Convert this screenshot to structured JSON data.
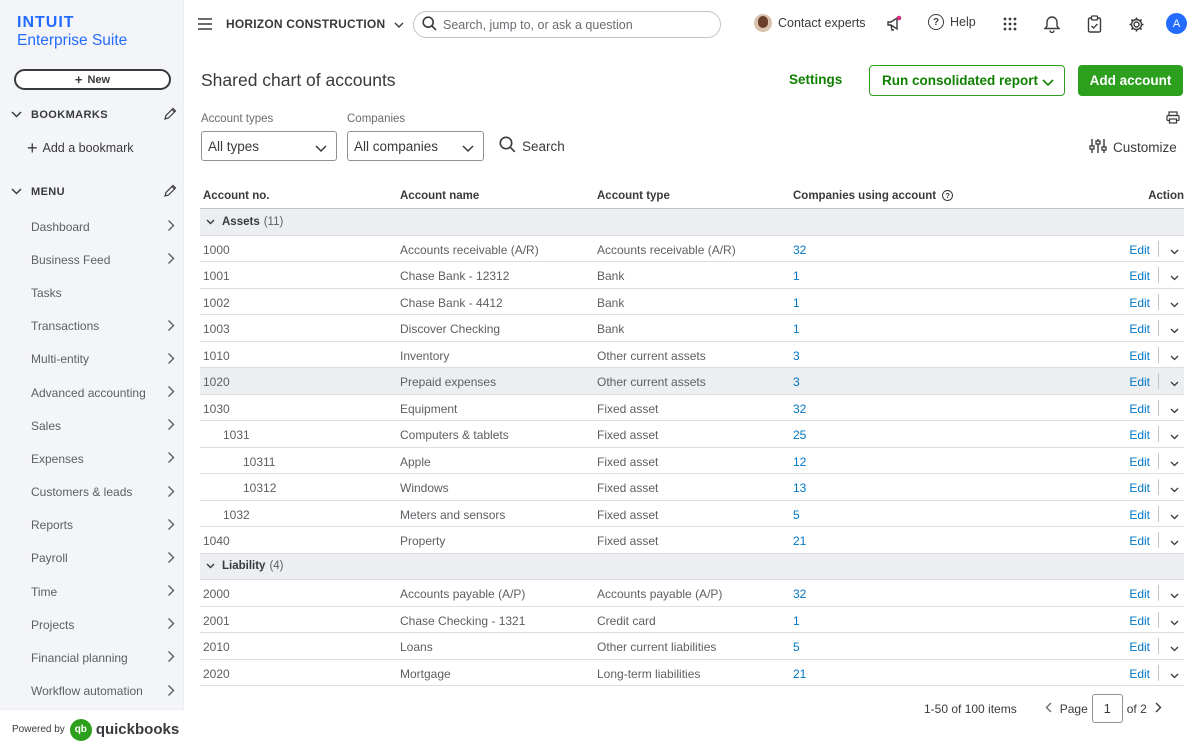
{
  "brand": {
    "line1": "INTUIT",
    "line2": "Enterprise Suite",
    "accent": "#236cff",
    "green": "#2ca01c"
  },
  "sidebar": {
    "new_label": "New",
    "bookmarks_label": "BOOKMARKS",
    "add_bookmark_label": "Add a bookmark",
    "menu_label": "MENU",
    "items": [
      {
        "label": "Dashboard",
        "arrow": true
      },
      {
        "label": "Business Feed",
        "arrow": true
      },
      {
        "label": "Tasks",
        "arrow": false
      },
      {
        "label": "Transactions",
        "arrow": true
      },
      {
        "label": "Multi-entity",
        "arrow": true
      },
      {
        "label": "Advanced accounting",
        "arrow": true
      },
      {
        "label": "Sales",
        "arrow": true
      },
      {
        "label": "Expenses",
        "arrow": true
      },
      {
        "label": "Customers & leads",
        "arrow": true
      },
      {
        "label": "Reports",
        "arrow": true
      },
      {
        "label": "Payroll",
        "arrow": true
      },
      {
        "label": "Time",
        "arrow": true
      },
      {
        "label": "Projects",
        "arrow": true
      },
      {
        "label": "Financial planning",
        "arrow": true
      },
      {
        "label": "Workflow automation",
        "arrow": true
      }
    ],
    "powered_by": "Powered by",
    "qb_mark": "qb",
    "qb_word": "quickbooks"
  },
  "topbar": {
    "company": "HORIZON CONSTRUCTION",
    "search_placeholder": "Search, jump to, or ask a question",
    "contact_label": "Contact experts",
    "help_label": "Help",
    "user_initial": "A"
  },
  "page": {
    "title": "Shared chart of accounts",
    "settings_label": "Settings",
    "run_report_label": "Run consolidated report",
    "add_account_label": "Add account",
    "account_types_label": "Account types",
    "account_types_value": "All types",
    "companies_label": "Companies",
    "companies_value": "All companies",
    "search_label": "Search",
    "customize_label": "Customize"
  },
  "table": {
    "headers": {
      "no": "Account no.",
      "name": "Account name",
      "type": "Account type",
      "companies": "Companies using account",
      "action": "Action"
    },
    "edit_label": "Edit",
    "groups": [
      {
        "name": "Assets",
        "count": "(11)",
        "rows": [
          {
            "no": "1000",
            "indent": 0,
            "name": "Accounts receivable (A/R)",
            "type": "Accounts receivable (A/R)",
            "companies": "32",
            "highlight": false
          },
          {
            "no": "1001",
            "indent": 0,
            "name": "Chase Bank - 12312",
            "type": "Bank",
            "companies": "1",
            "highlight": false
          },
          {
            "no": "1002",
            "indent": 0,
            "name": "Chase Bank - 4412",
            "type": "Bank",
            "companies": "1",
            "highlight": false
          },
          {
            "no": "1003",
            "indent": 0,
            "name": "Discover Checking",
            "type": "Bank",
            "companies": "1",
            "highlight": false
          },
          {
            "no": "1010",
            "indent": 0,
            "name": "Inventory",
            "type": "Other current assets",
            "companies": "3",
            "highlight": false
          },
          {
            "no": "1020",
            "indent": 0,
            "name": "Prepaid expenses",
            "type": "Other current assets",
            "companies": "3",
            "highlight": true
          },
          {
            "no": "1030",
            "indent": 0,
            "name": "Equipment",
            "type": "Fixed asset",
            "companies": "32",
            "highlight": false
          },
          {
            "no": "1031",
            "indent": 1,
            "name": "Computers & tablets",
            "type": "Fixed asset",
            "companies": "25",
            "highlight": false
          },
          {
            "no": "10311",
            "indent": 2,
            "name": "Apple",
            "type": "Fixed asset",
            "companies": "12",
            "highlight": false
          },
          {
            "no": "10312",
            "indent": 2,
            "name": "Windows",
            "type": "Fixed asset",
            "companies": "13",
            "highlight": false
          },
          {
            "no": "1032",
            "indent": 1,
            "name": "Meters and sensors",
            "type": "Fixed asset",
            "companies": "5",
            "highlight": false
          },
          {
            "no": "1040",
            "indent": 0,
            "name": "Property",
            "type": "Fixed asset",
            "companies": "21",
            "highlight": false
          }
        ]
      },
      {
        "name": "Liability",
        "count": "(4)",
        "rows": [
          {
            "no": "2000",
            "indent": 0,
            "name": "Accounts payable (A/P)",
            "type": "Accounts payable (A/P)",
            "companies": "32",
            "highlight": false
          },
          {
            "no": "2001",
            "indent": 0,
            "name": "Chase Checking - 1321",
            "type": "Credit card",
            "companies": "1",
            "highlight": false
          },
          {
            "no": "2010",
            "indent": 0,
            "name": "Loans",
            "type": "Other current liabilities",
            "companies": "5",
            "highlight": false
          },
          {
            "no": "2020",
            "indent": 0,
            "name": "Mortgage",
            "type": "Long-term liabilities",
            "companies": "21",
            "highlight": false
          }
        ]
      }
    ]
  },
  "pagination": {
    "range": "1-50 of 100 items",
    "page_label": "Page",
    "current": "1",
    "of_label": "of 2"
  }
}
